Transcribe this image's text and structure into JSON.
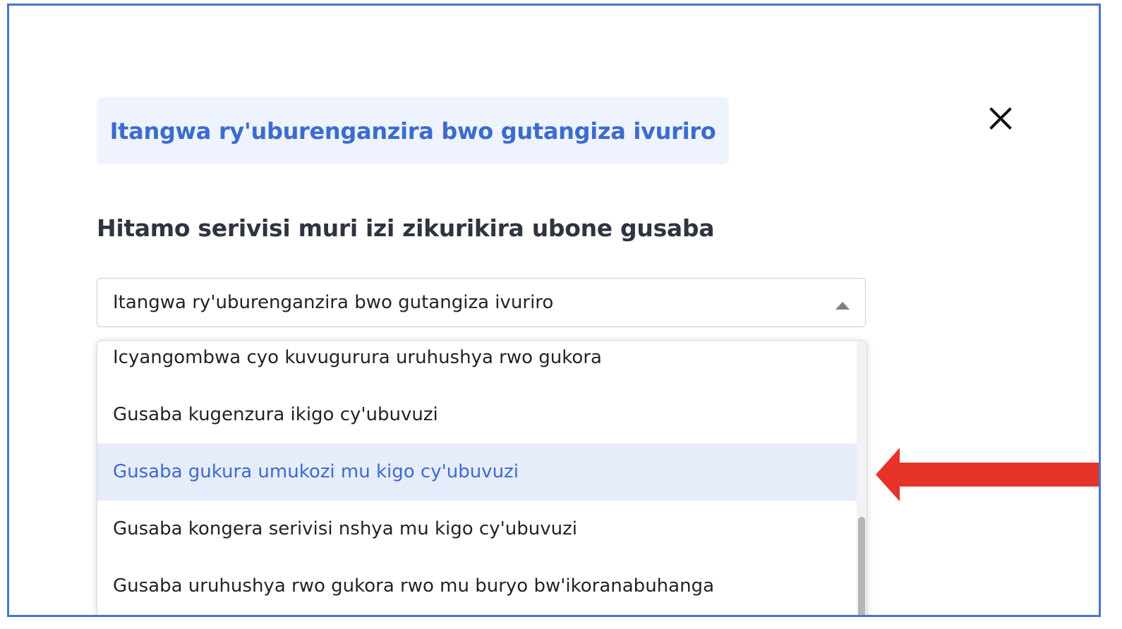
{
  "header": {
    "service_chip_label": "Itangwa ry'uburenganzira bwo gutangiza ivuriro"
  },
  "close_icon": "close-icon",
  "prompt": {
    "question": "Hitamo serivisi muri izi zikurikira ubone gusaba"
  },
  "select": {
    "selected_value": "Itangwa ry'uburenganzira bwo gutangiza ivuriro",
    "state": "open"
  },
  "dropdown": {
    "options": [
      {
        "label": "Icyangombwa cyo kuvugurura uruhushya rwo gukora"
      },
      {
        "label": "Gusaba kugenzura ikigo cy'ubuvuzi"
      },
      {
        "label": "Gusaba gukura umukozi mu kigo cy'ubuvuzi",
        "highlighted": true
      },
      {
        "label": "Gusaba kongera serivisi nshya mu kigo cy'ubuvuzi"
      },
      {
        "label": "Gusaba uruhushya rwo gukora rwo mu buryo bw'ikoranabuhanga"
      }
    ]
  },
  "colors": {
    "accent": "#3c6bd0",
    "chip_background": "#eef3fd",
    "highlight_background": "#e6ecf9",
    "annotation_arrow": "#e5332a",
    "frame_border": "#4a74c9"
  }
}
